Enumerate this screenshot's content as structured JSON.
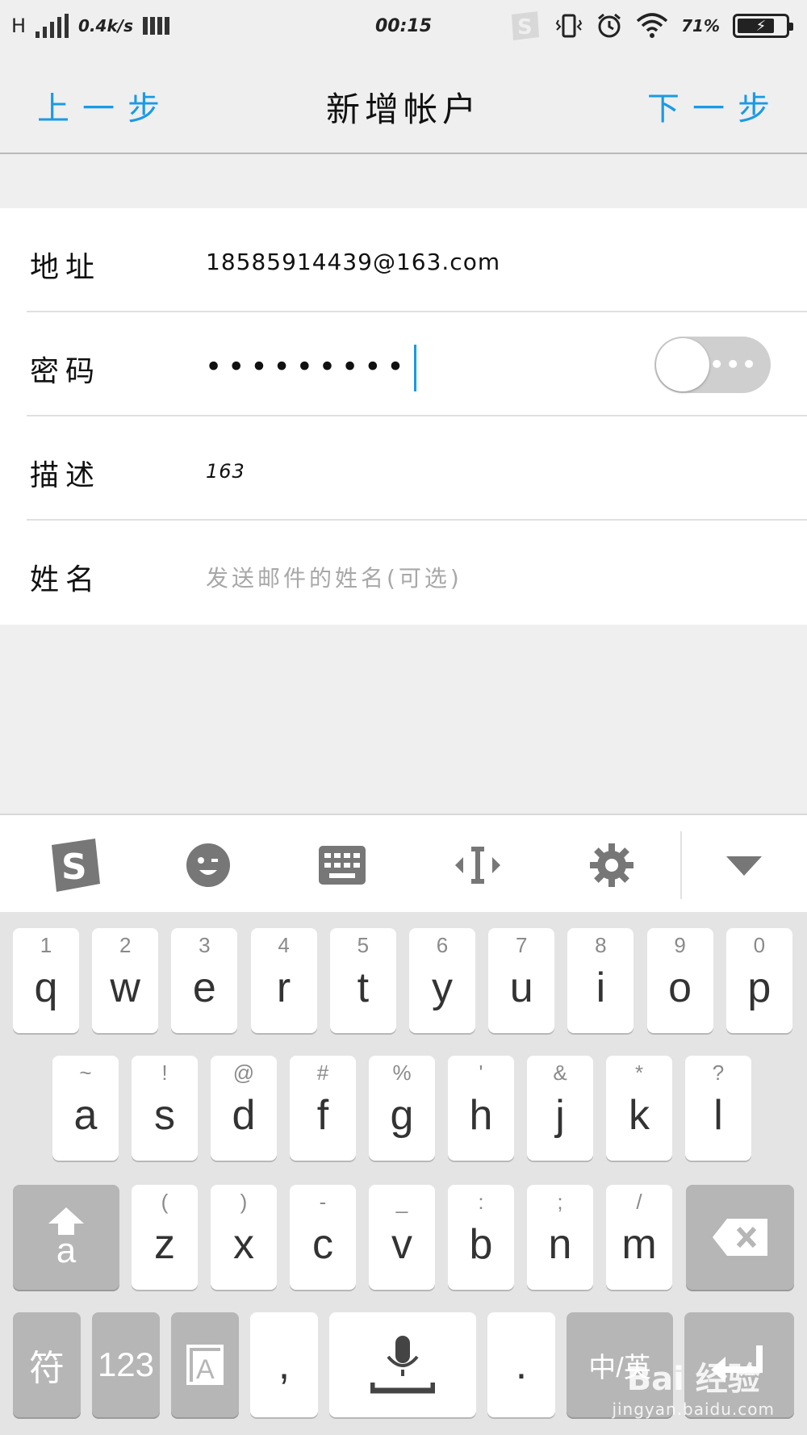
{
  "status_bar": {
    "network": "H",
    "speed": "0.4k/s",
    "time": "00:15",
    "battery": "71%"
  },
  "nav": {
    "back": "上一步",
    "title": "新增帐户",
    "next": "下一步"
  },
  "form": {
    "address_label": "地址",
    "address_value": "18585914439@163.com",
    "password_label": "密码",
    "password_value": "•••••••••",
    "description_label": "描述",
    "description_value": "163",
    "name_label": "姓名",
    "name_placeholder": "发送邮件的姓名(可选)"
  },
  "toolbar": {
    "icons": [
      "sogou-icon",
      "emoji-icon",
      "keyboard-icon",
      "cursor-move-icon",
      "gear-icon",
      "chevron-down-icon"
    ]
  },
  "keyboard": {
    "row1": [
      {
        "main": "q",
        "sub": "1"
      },
      {
        "main": "w",
        "sub": "2"
      },
      {
        "main": "e",
        "sub": "3"
      },
      {
        "main": "r",
        "sub": "4"
      },
      {
        "main": "t",
        "sub": "5"
      },
      {
        "main": "y",
        "sub": "6"
      },
      {
        "main": "u",
        "sub": "7"
      },
      {
        "main": "i",
        "sub": "8"
      },
      {
        "main": "o",
        "sub": "9"
      },
      {
        "main": "p",
        "sub": "0"
      }
    ],
    "row2": [
      {
        "main": "a",
        "sub": "~"
      },
      {
        "main": "s",
        "sub": "!"
      },
      {
        "main": "d",
        "sub": "@"
      },
      {
        "main": "f",
        "sub": "#"
      },
      {
        "main": "g",
        "sub": "%"
      },
      {
        "main": "h",
        "sub": "'"
      },
      {
        "main": "j",
        "sub": "&"
      },
      {
        "main": "k",
        "sub": "*"
      },
      {
        "main": "l",
        "sub": "?"
      }
    ],
    "row3": [
      {
        "main": "z",
        "sub": "("
      },
      {
        "main": "x",
        "sub": ")"
      },
      {
        "main": "c",
        "sub": "-"
      },
      {
        "main": "v",
        "sub": "_"
      },
      {
        "main": "b",
        "sub": ":"
      },
      {
        "main": "n",
        "sub": ";"
      },
      {
        "main": "m",
        "sub": "/"
      }
    ],
    "shift_label": "a",
    "symbols_label": "符",
    "numbers_label": "123",
    "comma_label": ",",
    "period_label": ".",
    "lang_label": "中/英"
  },
  "watermark": {
    "main": "Bai 经验",
    "sub": "jingyan.baidu.com"
  }
}
